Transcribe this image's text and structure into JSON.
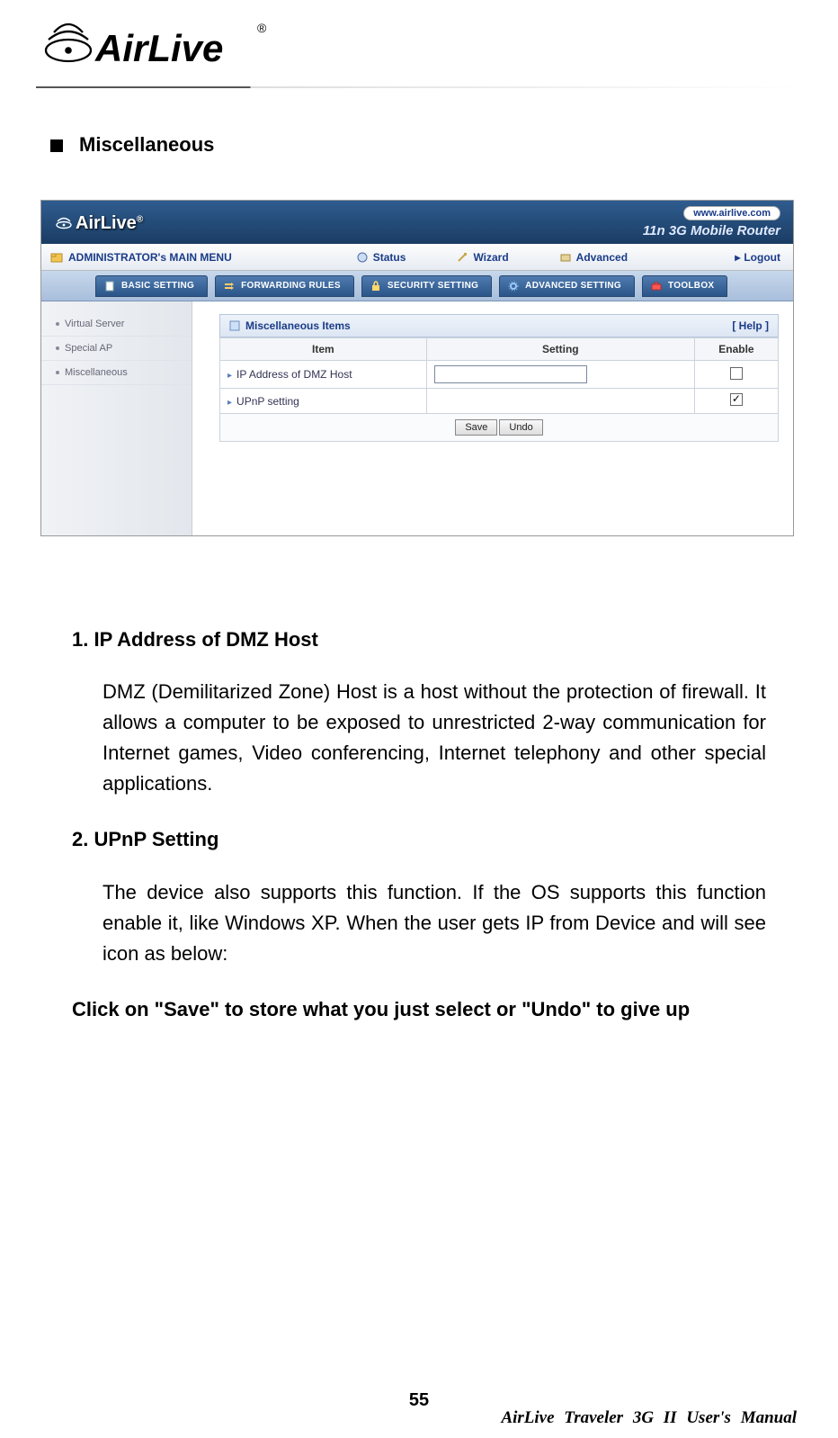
{
  "logo_text": "AirLive",
  "section_heading": "Miscellaneous",
  "screenshot": {
    "brand": "AirLive",
    "site_url": "www.airlive.com",
    "tagline": "11n 3G Mobile Router",
    "main_menu": {
      "title": "ADMINISTRATOR's MAIN MENU",
      "items": [
        "Status",
        "Wizard",
        "Advanced"
      ],
      "logout": "Logout"
    },
    "tabs": [
      "BASIC SETTING",
      "FORWARDING RULES",
      "SECURITY SETTING",
      "ADVANCED SETTING",
      "TOOLBOX"
    ],
    "sidebar": [
      "Virtual Server",
      "Special AP",
      "Miscellaneous"
    ],
    "panel_title": "Miscellaneous Items",
    "help_label": "[ Help ]",
    "columns": {
      "item": "Item",
      "setting": "Setting",
      "enable": "Enable"
    },
    "rows": [
      {
        "label": "IP Address of DMZ Host",
        "has_input": true,
        "checked": false
      },
      {
        "label": "UPnP setting",
        "has_input": false,
        "checked": true
      }
    ],
    "buttons": {
      "save": "Save",
      "undo": "Undo"
    }
  },
  "items": [
    {
      "num": "1.",
      "title": "IP Address of DMZ Host",
      "desc": "DMZ (Demilitarized Zone) Host is a host without the protection of firewall. It allows a computer to be exposed to unrestricted 2-way communication for Internet games, Video conferencing, Internet telephony and other special applications."
    },
    {
      "num": "2.",
      "title": "UPnP Setting",
      "desc": "The device also supports this function. If the OS supports this function enable it, like Windows XP. When the user gets IP from Device and will see icon as below:"
    }
  ],
  "closing": "Click on \"Save\" to store what you just select or \"Undo\" to give up",
  "page_number": "55",
  "footer_title": "AirLive Traveler 3G II User's Manual"
}
